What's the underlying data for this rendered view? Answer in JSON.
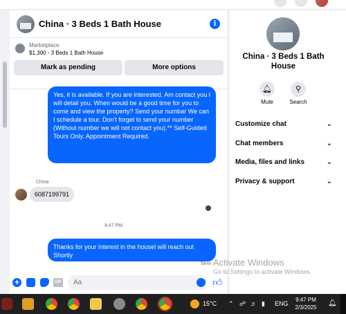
{
  "header": {
    "title": "China · 3 Beds 1 Bath House"
  },
  "marketplace": {
    "label": "Marketplace",
    "detail": "$1,300 - 3 Beds 1 Bath House",
    "mark_pending": "Mark as pending",
    "more_options": "More options"
  },
  "messages": {
    "outgoing_1": "Yes, it is available. If you are interested.  Am contact you i will detail you.  When would be a good time for you to come and view the property? Send your numbar We can I schedule a tour.  Don't forget to send your number (Without number we will not contact you).** Self-Guided Tours Only. Appointment Required.",
    "sender_name": "China",
    "incoming_1": "6087199791",
    "time_separator": "9:47 PM",
    "outgoing_2": "Thanks for your interest in the housel will reach out Shortly",
    "status": "Sent"
  },
  "composer": {
    "placeholder": "Aa",
    "gif_label": "GIF"
  },
  "details": {
    "title": "China · 3 Beds 1 Bath House",
    "mute": "Mute",
    "search": "Search",
    "items": [
      "Customize chat",
      "Chat members",
      "Media, files and links",
      "Privacy & support"
    ]
  },
  "watermark": {
    "line1": "Activate Windows",
    "line2": "Go to Settings to activate Windows."
  },
  "taskbar": {
    "temperature": "15°C",
    "language": "ENG",
    "time": "9:47 PM",
    "date": "2/3/2025"
  },
  "colors": {
    "accent": "#0866ff",
    "taskbar": "#202020"
  },
  "icons": [
    "apps-icon",
    "notification-icon",
    "profile-icon",
    "info-icon",
    "plus-icon",
    "image-icon",
    "sticker-icon",
    "gif-icon",
    "emoji-icon",
    "like-icon",
    "bell-icon",
    "search-icon",
    "chevron-down-icon",
    "windows-start-icon",
    "chrome-icon",
    "folder-icon",
    "weather-icon"
  ]
}
